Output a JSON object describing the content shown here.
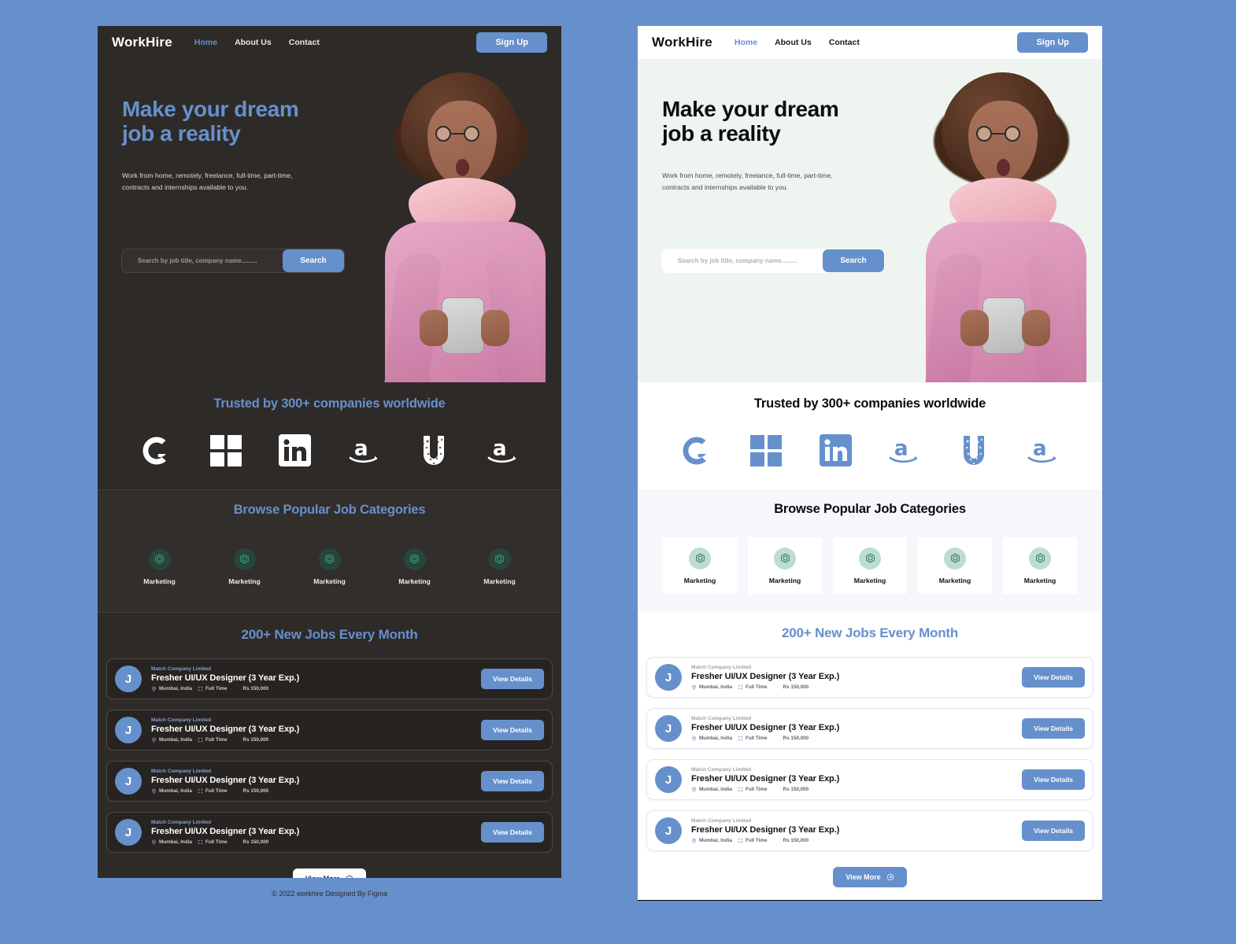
{
  "page": {
    "background_color": "#6690cc",
    "accent_blue": "#6690cc",
    "dark_surface": "#2e2a28",
    "light_surface": "#ffffff",
    "hero_light_bg": "#eef4ef",
    "cats_light_bg": "#f5f7fa"
  },
  "nav": {
    "brand": "WorkHire",
    "links": [
      {
        "label": "Home",
        "active": true
      },
      {
        "label": "About Us",
        "active": false
      },
      {
        "label": "Contact",
        "active": false
      }
    ],
    "signup_label": "Sign Up"
  },
  "hero": {
    "heading_line1": "Make your dream",
    "heading_line2": "job a reality",
    "subtext_line1": "Work from home, remotely, freelance, full-time, part-time,",
    "subtext_line2": "contracts and internships available to you.",
    "search_placeholder": "Search by job title, company name.........",
    "search_value": "",
    "search_button": "Search"
  },
  "trusted": {
    "heading": "Trusted by 300+ companies worldwide",
    "logos": [
      {
        "name": "google-logo",
        "alt": "Google"
      },
      {
        "name": "microsoft-logo",
        "alt": "Microsoft"
      },
      {
        "name": "linkedin-logo",
        "alt": "LinkedIn"
      },
      {
        "name": "amazon-logo",
        "alt": "Amazon"
      },
      {
        "name": "unilever-logo",
        "alt": "Unilever"
      },
      {
        "name": "amazon-logo-2",
        "alt": "Amazon"
      }
    ]
  },
  "categories": {
    "heading": "Browse Popular Job Categories",
    "items": [
      {
        "label": "Marketing",
        "icon": "cube-icon"
      },
      {
        "label": "Marketing",
        "icon": "cube-icon"
      },
      {
        "label": "Marketing",
        "icon": "cube-icon"
      },
      {
        "label": "Marketing",
        "icon": "cube-icon"
      },
      {
        "label": "Marketing",
        "icon": "cube-icon"
      }
    ]
  },
  "jobs": {
    "heading": "200+ New Jobs Every Month",
    "view_more_label": "View More",
    "view_details_label": "View Details",
    "items": [
      {
        "avatar": "J",
        "company": "Match Company Limited",
        "title": "Fresher UI/UX Designer (3 Year Exp.)",
        "location": "Mumbai, India",
        "type": "Full Time",
        "salary": "Rs 150,000"
      },
      {
        "avatar": "J",
        "company": "Match Company Limited",
        "title": "Fresher UI/UX Designer (3 Year Exp.)",
        "location": "Mumbai, India",
        "type": "Full Time",
        "salary": "Rs 150,000"
      },
      {
        "avatar": "J",
        "company": "Match Company Limited",
        "title": "Fresher UI/UX Designer (3 Year Exp.)",
        "location": "Mumbai, India",
        "type": "Full Time",
        "salary": "Rs 150,000"
      },
      {
        "avatar": "J",
        "company": "Match Company Limited",
        "title": "Fresher UI/UX Designer (3 Year Exp.)",
        "location": "Mumbai, India",
        "type": "Full Time",
        "salary": "Rs 150,000"
      }
    ]
  },
  "footer": {
    "text": "© 2022 workhire Designed By Figma"
  }
}
